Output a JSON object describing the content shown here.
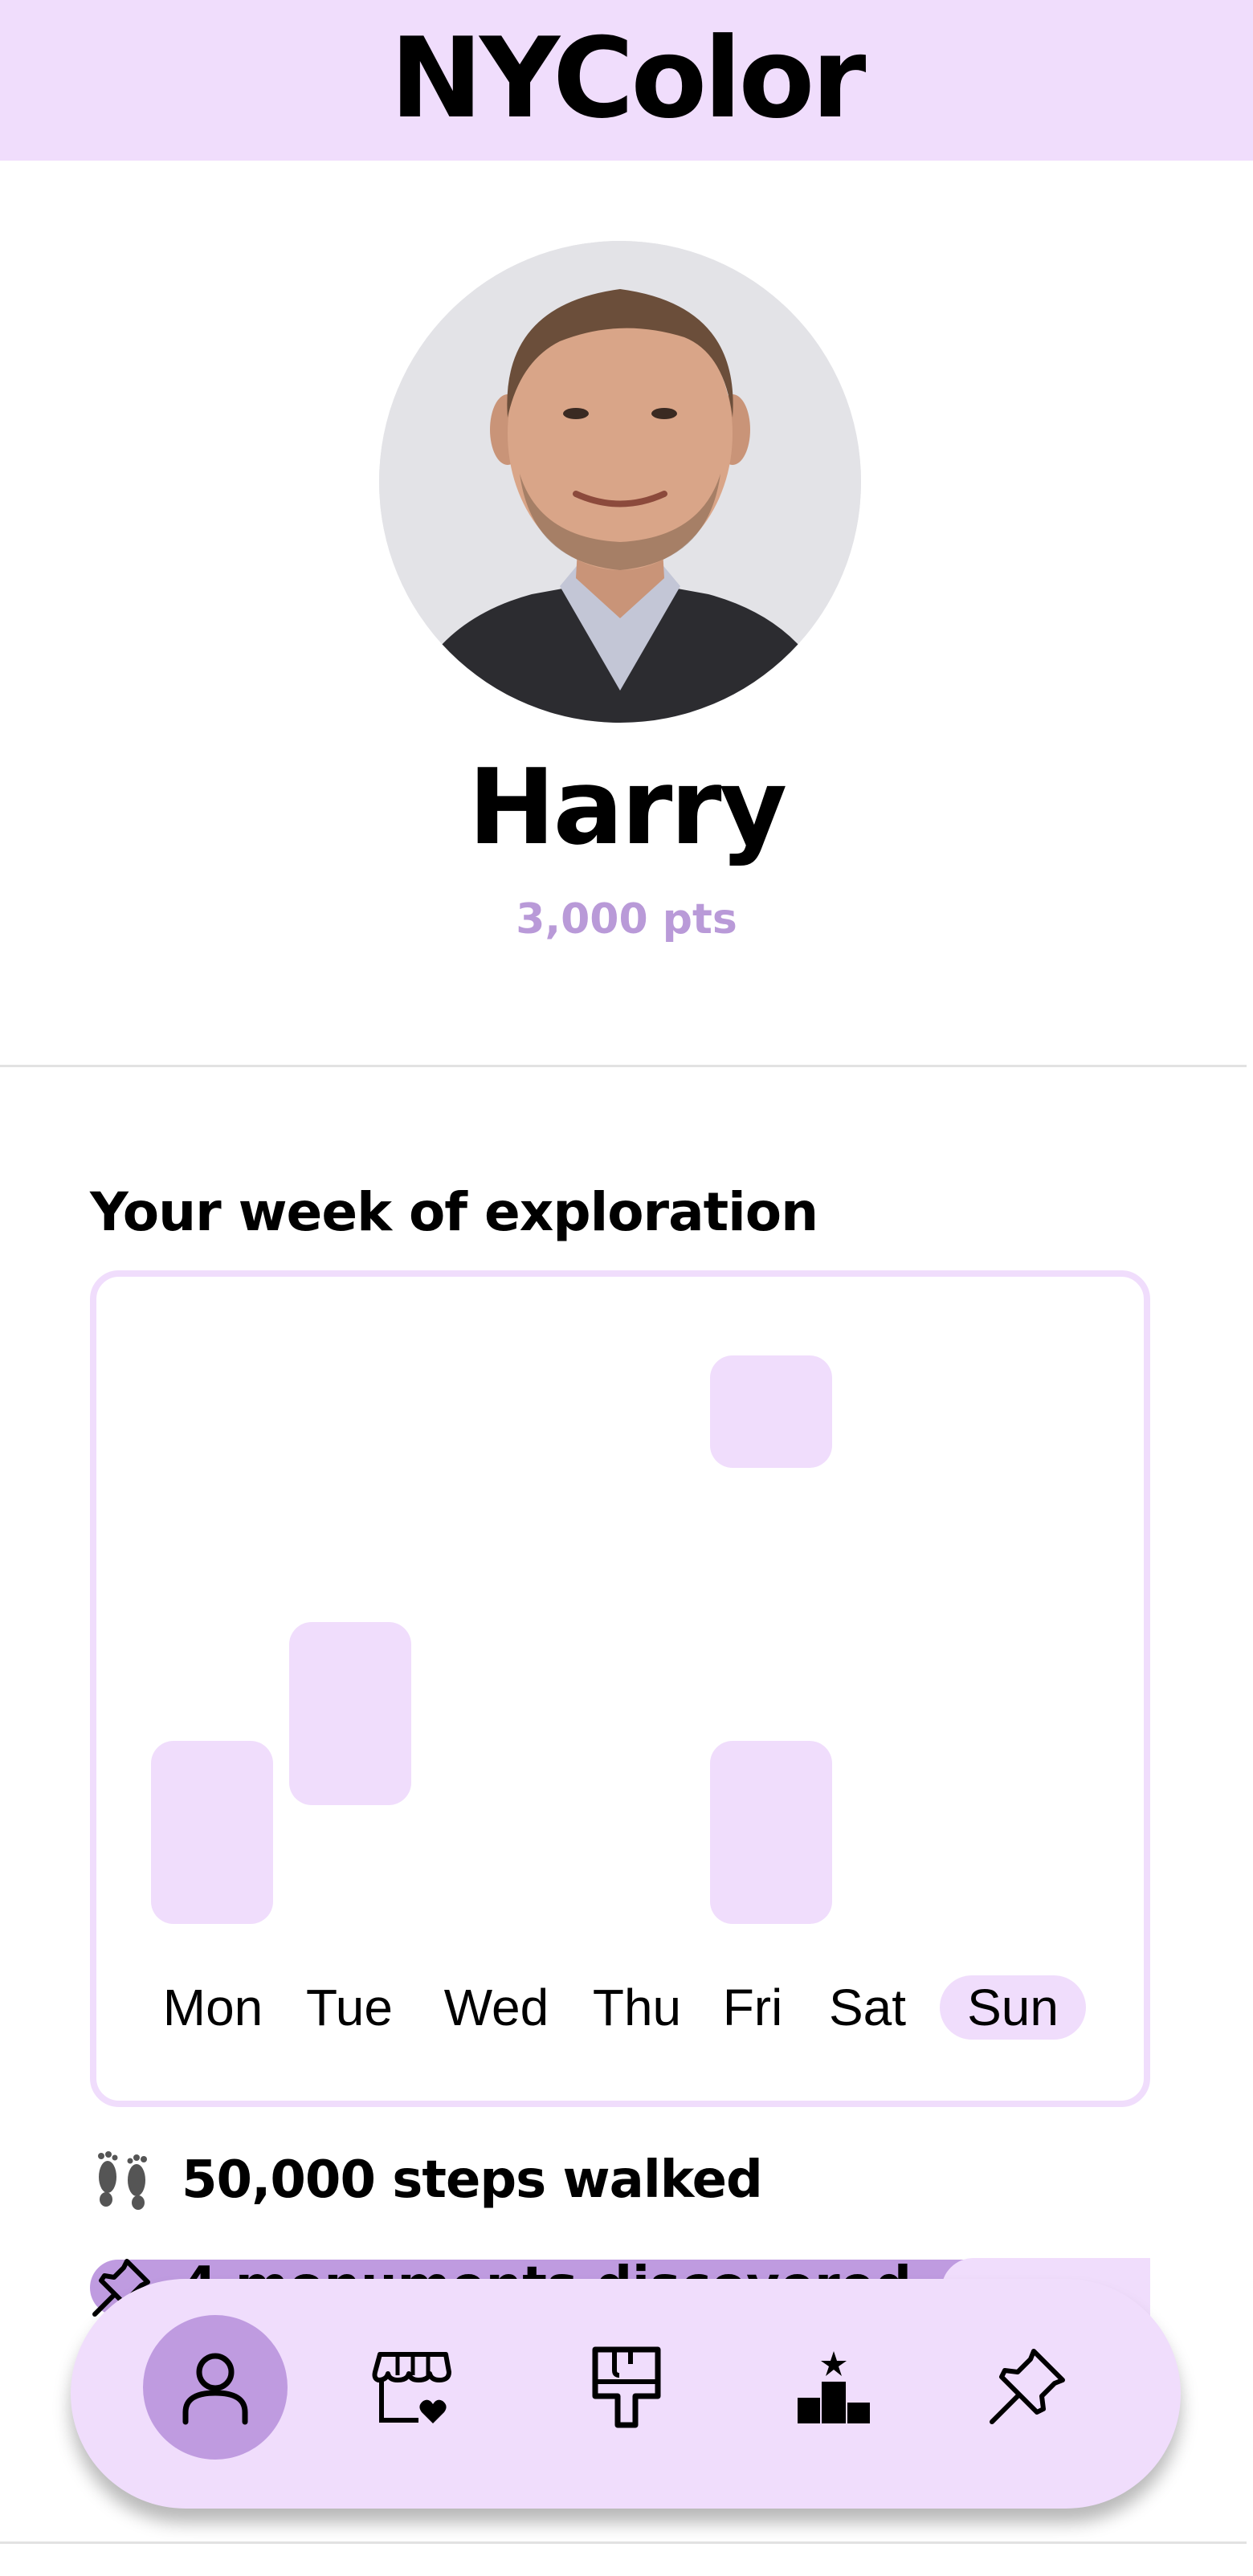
{
  "header": {
    "title": "NYColor"
  },
  "profile": {
    "name": "Harry",
    "points": "3,000 pts"
  },
  "week": {
    "title": "Your week of exploration",
    "days": [
      {
        "label": "Mon",
        "active": false
      },
      {
        "label": "Tue",
        "active": false
      },
      {
        "label": "Wed",
        "active": false
      },
      {
        "label": "Thu",
        "active": false
      },
      {
        "label": "Fri",
        "active": false
      },
      {
        "label": "Sat",
        "active": false
      },
      {
        "label": "Sun",
        "active": true
      }
    ]
  },
  "stats": [
    {
      "icon": "footprints-icon",
      "text": "50,000 steps walked"
    },
    {
      "icon": "pushpin-icon",
      "text": "4 monuments discovered"
    }
  ],
  "nav": {
    "items": [
      {
        "name": "profile",
        "icon": "person-icon",
        "active": true
      },
      {
        "name": "shop",
        "icon": "storefront-heart-icon",
        "active": false
      },
      {
        "name": "paint",
        "icon": "paint-roller-icon",
        "active": false
      },
      {
        "name": "leaderboard",
        "icon": "podium-star-icon",
        "active": false
      },
      {
        "name": "pins",
        "icon": "pushpin-icon",
        "active": false
      }
    ]
  },
  "colors": {
    "accent_light": "#f0ddfc",
    "accent": "#bf9be0",
    "points_text": "#b99ad8"
  }
}
